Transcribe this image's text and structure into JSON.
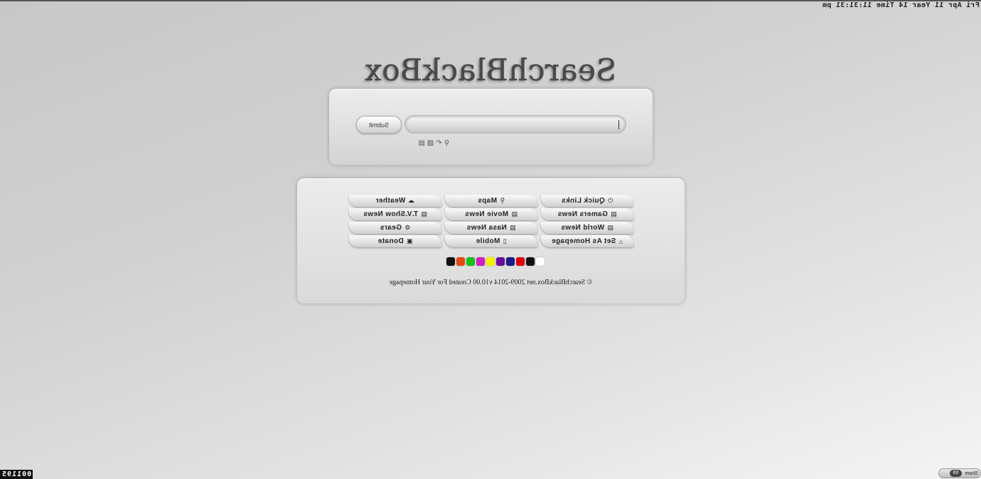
{
  "header": {
    "datetime": "Fri Apr 11 Year 14 Time 11:31:31 pm",
    "logo": "SearchBlackBox"
  },
  "search": {
    "placeholder": "",
    "value": "",
    "submit_label": "Submit",
    "engine_icons": [
      "search-icon",
      "undo-icon",
      "image-icon",
      "doc-icon"
    ]
  },
  "links": [
    {
      "label": "Quick Links",
      "icon": "⏻",
      "icon_name": "power-icon"
    },
    {
      "label": "Maps",
      "icon": "⚲",
      "icon_name": "map-pin-icon"
    },
    {
      "label": "Weather",
      "icon": "☁",
      "icon_name": "cloud-icon"
    },
    {
      "label": "Gamers News",
      "icon": "▤",
      "icon_name": "newspaper-icon"
    },
    {
      "label": "Movie News",
      "icon": "▤",
      "icon_name": "newspaper-icon"
    },
    {
      "label": "T.V.Show News",
      "icon": "▤",
      "icon_name": "newspaper-icon"
    },
    {
      "label": "World News",
      "icon": "▤",
      "icon_name": "newspaper-icon"
    },
    {
      "label": "Nasa News",
      "icon": "▤",
      "icon_name": "newspaper-icon"
    },
    {
      "label": "Gears",
      "icon": "⚙",
      "icon_name": "gear-icon"
    },
    {
      "label": "Set As Homepage",
      "icon": "⌂",
      "icon_name": "home-icon"
    },
    {
      "label": "Mobile",
      "icon": "▯",
      "icon_name": "mobile-icon"
    },
    {
      "label": "Donate",
      "icon": "▣",
      "icon_name": "money-icon"
    }
  ],
  "swatches": [
    "#ffffff",
    "#111111",
    "#e00000",
    "#1a1a8c",
    "#6a0aa0",
    "#f4f000",
    "#d21cc0",
    "#18c018",
    "#e04a10",
    "#101010"
  ],
  "footer": {
    "text": "© SearchBlackBox.net 2009-2014 v10.00 Created For Your Homepage"
  },
  "counter": "001195",
  "share": {
    "label": "Share",
    "count": "69"
  }
}
